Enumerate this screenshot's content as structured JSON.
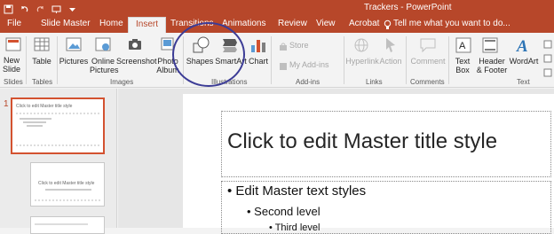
{
  "window": {
    "title": "Trackers - PowerPoint"
  },
  "tabs": [
    "File",
    "Slide Master",
    "Home",
    "Insert",
    "Transitions",
    "Animations",
    "Review",
    "View",
    "Acrobat"
  ],
  "tell_me": "Tell me what you want to do...",
  "ribbon": {
    "new_slide": [
      "New",
      "Slide"
    ],
    "table": "Table",
    "pictures": "Pictures",
    "online_pictures": [
      "Online",
      "Pictures"
    ],
    "screenshot": "Screenshot",
    "photo_album": [
      "Photo",
      "Album"
    ],
    "shapes": "Shapes",
    "smartart": "SmartArt",
    "chart": "Chart",
    "store": "Store",
    "my_addins": "My Add-ins",
    "hyperlink": "Hyperlink",
    "action": "Action",
    "comment": "Comment",
    "text_box": [
      "Text",
      "Box"
    ],
    "header_footer": [
      "Header",
      "& Footer"
    ],
    "wordart": "WordArt",
    "groups": {
      "slides": "Slides",
      "tables": "Tables",
      "images": "Images",
      "illustrations": "Illustrations",
      "addins": "Add-ins",
      "links": "Links",
      "comments": "Comments",
      "text": "Text"
    }
  },
  "thumbnails": {
    "number": "1",
    "thumb1_title": "Click to edit Master title style",
    "thumb2_title": "Click to edit Master title style"
  },
  "slide": {
    "title": "Click to edit Master title style",
    "level1": "• Edit Master text styles",
    "level2": "• Second level",
    "level3": "• Third level"
  },
  "colors": {
    "accent": "#b7472a",
    "circle": "#3c3c96"
  }
}
